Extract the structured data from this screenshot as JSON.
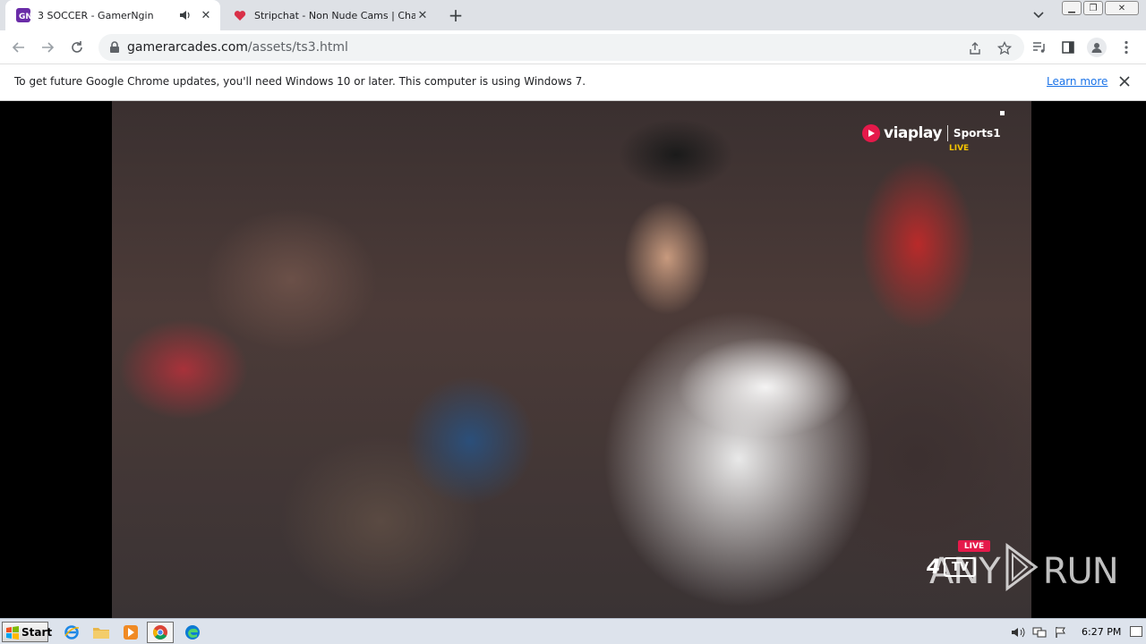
{
  "tabs": [
    {
      "title": "3 SOCCER - GamerNgin",
      "active": true,
      "favicon": "gamerngin-favicon",
      "audio": true
    },
    {
      "title": "Stripchat - Non Nude Cams | Chat wi",
      "active": false,
      "favicon": "heart-favicon",
      "audio": false
    }
  ],
  "toolbar": {
    "url_domain": "gamerarcades.com",
    "url_path": "/assets/ts3.html"
  },
  "infobar": {
    "message": "To get future Google Chrome updates, you'll need Windows 10 or later. This computer is using Windows 7.",
    "link": "Learn more"
  },
  "video": {
    "brand": "viaplay",
    "channel": "Sports1",
    "live": "LIVE",
    "badge_live": "LIVE",
    "badge_tv": "TV",
    "badge_4": "4"
  },
  "watermark": {
    "left": "ANY",
    "right": "RUN"
  },
  "taskbar": {
    "start": "Start",
    "clock": "6:27 PM"
  },
  "colors": {
    "accent": "#1a73e8",
    "viaplay": "#e5194a",
    "live": "#f5c400"
  }
}
